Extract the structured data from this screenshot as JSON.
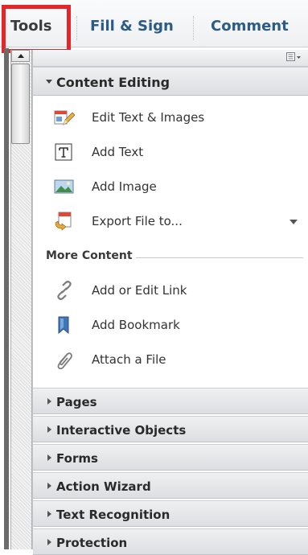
{
  "tabs": {
    "tools": "Tools",
    "fill_sign": "Fill & Sign",
    "comment": "Comment"
  },
  "panel": {
    "content_editing": {
      "title": "Content Editing",
      "items": [
        {
          "label": "Edit Text & Images",
          "icon": "edit-text-images-icon"
        },
        {
          "label": "Add Text",
          "icon": "add-text-icon"
        },
        {
          "label": "Add Image",
          "icon": "add-image-icon"
        },
        {
          "label": "Export File to...",
          "icon": "export-file-icon"
        }
      ]
    },
    "more_content": {
      "title": "More Content",
      "items": [
        {
          "label": "Add or Edit Link",
          "icon": "link-icon"
        },
        {
          "label": "Add Bookmark",
          "icon": "bookmark-icon"
        },
        {
          "label": "Attach a File",
          "icon": "paperclip-icon"
        }
      ]
    },
    "sections": [
      "Pages",
      "Interactive Objects",
      "Forms",
      "Action Wizard",
      "Text Recognition",
      "Protection"
    ]
  },
  "colors": {
    "highlight": "#e4262a",
    "tab_text": "#2c5b86"
  }
}
